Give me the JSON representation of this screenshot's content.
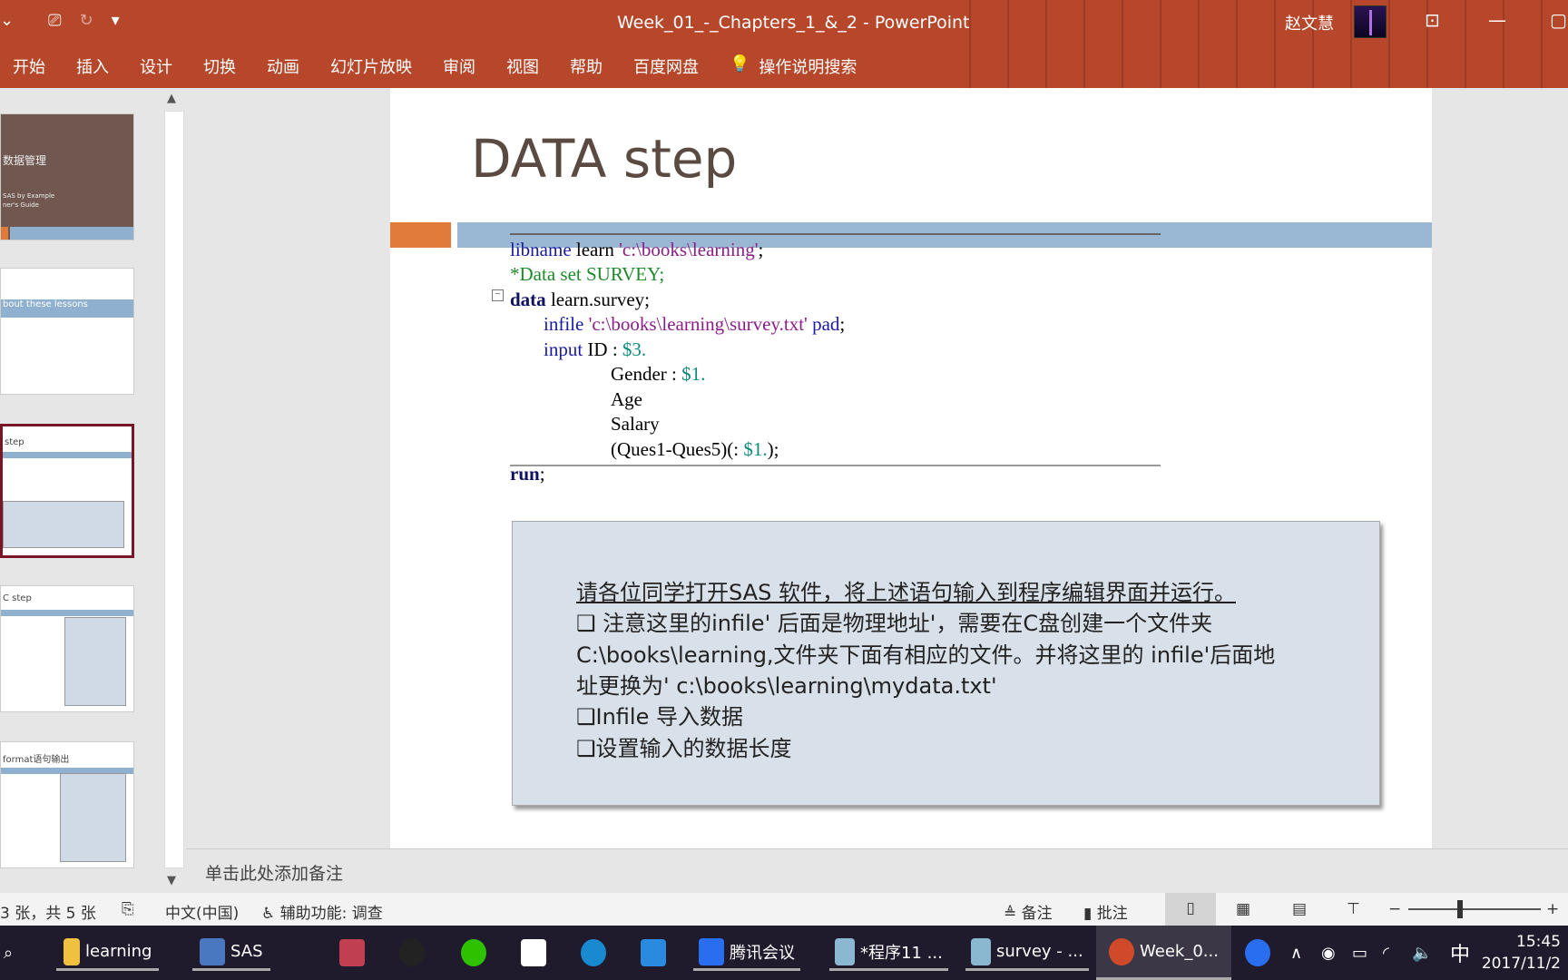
{
  "window": {
    "title": "Week_01_-_Chapters_1_&_2  -  PowerPoint",
    "user": "赵文慧"
  },
  "ribbon_tabs": [
    "开始",
    "插入",
    "设计",
    "切换",
    "动画",
    "幻灯片放映",
    "审阅",
    "视图",
    "帮助",
    "百度网盘"
  ],
  "tell_me": "操作说明搜索",
  "thumbnails": [
    {
      "title": "数据管理",
      "sub1": "SAS by Example",
      "sub2": "ner's Guide"
    },
    {
      "title": "bout these lessons"
    },
    {
      "title": "step"
    },
    {
      "title": "C step"
    },
    {
      "title": "format语句输出"
    }
  ],
  "slide": {
    "title": "DATA step",
    "code": {
      "l1": {
        "kw": "libname",
        "t": " learn ",
        "s": "'c:\\books\\learning'",
        "e": ";"
      },
      "l2": "*Data set SURVEY;",
      "l3": {
        "kw": "data",
        "t": " learn.survey;"
      },
      "l4": {
        "kw": "infile",
        "s": " 'c:\\books\\learning\\survey.txt'",
        "k2": " pad",
        "e": ";"
      },
      "l5": {
        "kw": "input",
        "t": " ID : ",
        "n": "$3."
      },
      "l6": {
        "t": "Gender : ",
        "n": "$1."
      },
      "l7": "Age",
      "l8": "Salary",
      "l9": {
        "t": "(Ques1-Ques5)(: ",
        "n": "$1.",
        "e": ");"
      },
      "l10": {
        "kw": "run",
        "e": ";"
      }
    },
    "note": {
      "line1": "请各位同学打开SAS 软件，将上述语句输入到程序编辑界面并运行。",
      "line2": "❑ 注意这里的infile' 后面是物理地址'，需要在C盘创建一个文件夹",
      "line3": "C:\\books\\learning,文件夹下面有相应的文件。并将这里的 infile'后面地",
      "line4": "址更换为' c:\\books\\learning\\mydata.txt'",
      "line5": "❑Infile 导入数据",
      "line6": "❑设置输入的数据长度"
    }
  },
  "notes_placeholder": "单击此处添加备注",
  "status": {
    "slide": "3 张，共 5 张",
    "lang": "中文(中国)",
    "access": "辅助功能: 调查",
    "notes": "备注",
    "comments": "批注"
  },
  "taskbar": {
    "items": [
      "learning",
      "SAS",
      "腾讯会议",
      "*程序11 ...",
      "survey - ...",
      "Week_0..."
    ],
    "ime": "中",
    "time": "15:45",
    "date": "2017/11/2"
  }
}
